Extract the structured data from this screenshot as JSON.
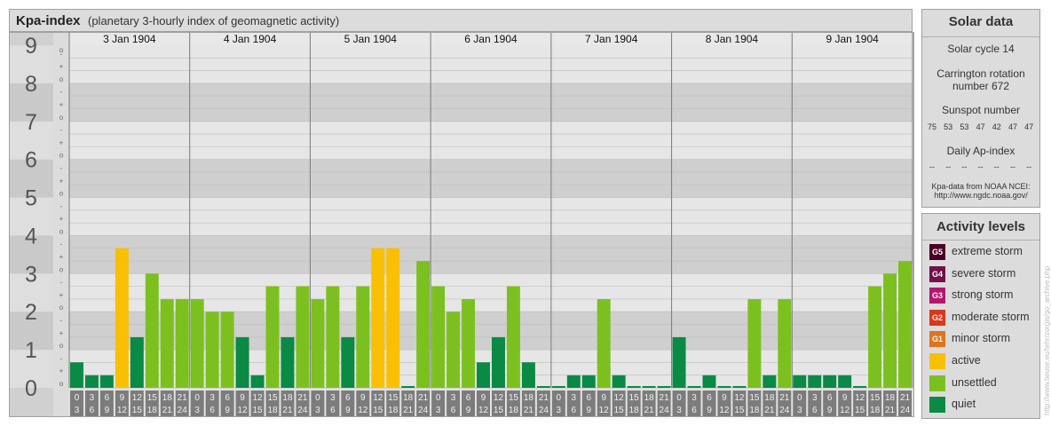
{
  "header": {
    "title": "Kpa-index",
    "subtitle": "(planetary 3-hourly index of geomagnetic activity)"
  },
  "solar": {
    "title": "Solar data",
    "cycle": "Solar cycle 14",
    "carrington_line1": "Carrington rotation",
    "carrington_line2": "number 672",
    "sunspot_title": "Sunspot number",
    "sunspots": [
      "75",
      "53",
      "53",
      "47",
      "42",
      "47",
      "47"
    ],
    "ap_title": "Daily Ap-index",
    "ap_values": [
      "--",
      "--",
      "--",
      "--",
      "--",
      "--",
      "--"
    ],
    "source_line1": "Kpa-data from NOAA NCEI:",
    "source_line2": "http://www.ngdc.noaa.gov/"
  },
  "activity": {
    "title": "Activity levels",
    "items": [
      {
        "code": "G5",
        "label": "extreme storm",
        "color": "#4a0024"
      },
      {
        "code": "G4",
        "label": "severe storm",
        "color": "#72104a"
      },
      {
        "code": "G3",
        "label": "strong storm",
        "color": "#b5166c"
      },
      {
        "code": "G2",
        "label": "moderate storm",
        "color": "#d9381c"
      },
      {
        "code": "G1",
        "label": "minor storm",
        "color": "#e0741c"
      },
      {
        "code": "",
        "label": "active",
        "color": "#f8c000"
      },
      {
        "code": "",
        "label": "unsettled",
        "color": "#7cc020"
      },
      {
        "code": "",
        "label": "quiet",
        "color": "#0a8a44"
      }
    ]
  },
  "watermark": "http://www.tieuse.eu/tehr/zorgis/go_archive.php",
  "chart_data": {
    "type": "bar",
    "title": "Kpa-index",
    "ylim": [
      0,
      9
    ],
    "y_ticks": [
      "0",
      "1",
      "2",
      "3",
      "4",
      "5",
      "6",
      "7",
      "8",
      "9"
    ],
    "y_subticks": [
      "o",
      "+",
      "-"
    ],
    "days": [
      "3 Jan 1904",
      "4 Jan 1904",
      "5 Jan 1904",
      "6 Jan 1904",
      "7 Jan 1904",
      "8 Jan 1904",
      "9 Jan 1904"
    ],
    "hour_labels_top": [
      "0",
      "3",
      "6",
      "9",
      "12",
      "15",
      "18",
      "21"
    ],
    "hour_labels_bottom": [
      "3",
      "6",
      "9",
      "12",
      "15",
      "18",
      "21",
      "24"
    ],
    "colors": {
      "quiet": "#0a8a44",
      "unsettled": "#7cc020",
      "active": "#f8c000"
    },
    "values": [
      [
        0.67,
        0.33,
        0.33,
        3.67,
        1.33,
        3.0,
        2.33,
        2.33
      ],
      [
        2.33,
        2.0,
        2.0,
        1.33,
        0.33,
        2.67,
        1.33,
        2.67
      ],
      [
        2.33,
        2.67,
        1.33,
        2.67,
        3.67,
        3.67,
        0.0,
        3.33
      ],
      [
        2.67,
        2.0,
        2.33,
        0.67,
        1.33,
        2.67,
        0.67,
        0.0
      ],
      [
        0.0,
        0.33,
        0.33,
        2.33,
        0.33,
        0.0,
        0.0,
        0.0
      ],
      [
        1.33,
        0.0,
        0.33,
        0.0,
        0.0,
        2.33,
        0.33,
        2.33
      ],
      [
        0.33,
        0.33,
        0.33,
        0.33,
        0.0,
        2.67,
        3.0,
        3.33
      ]
    ]
  }
}
